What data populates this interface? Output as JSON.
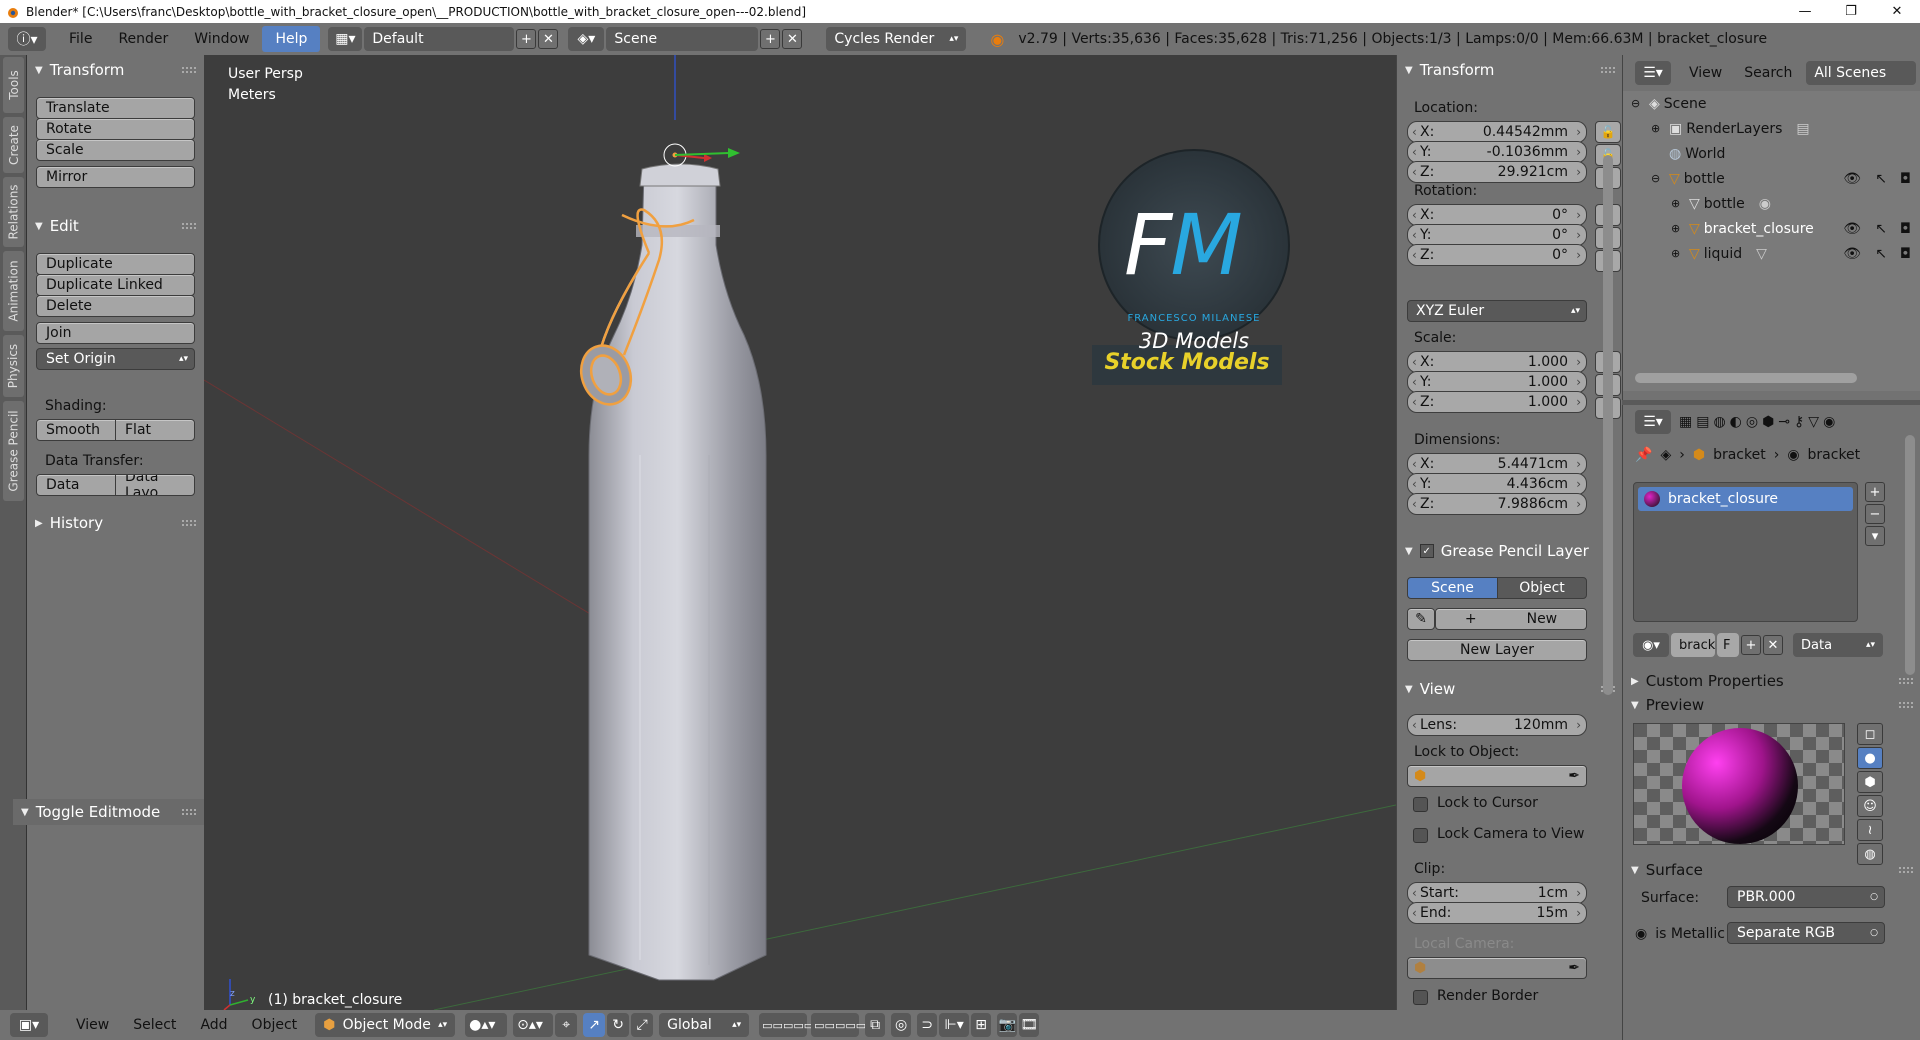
{
  "window": {
    "title": "Blender* [C:\\Users\\franc\\Desktop\\bottle_with_bracket_closure_open\\__PRODUCTION\\bottle_with_bracket_closure_open---02.blend]",
    "minimize": "—",
    "maximize": "❐",
    "close": "✕"
  },
  "menubar": {
    "items": [
      "File",
      "Render",
      "Window",
      "Help"
    ],
    "active": "Help",
    "layout": "Default",
    "scene": "Scene",
    "engine": "Cycles Render",
    "stats": "v2.79 | Verts:35,636 | Faces:35,628 | Tris:71,256 | Objects:1/3 | Lamps:0/0 | Mem:66.63M | bracket_closure"
  },
  "vtabs": [
    "Tools",
    "Create",
    "Relations",
    "Animation",
    "Physics",
    "Grease Pencil"
  ],
  "toolshelf": {
    "transform_title": "Transform",
    "translate": "Translate",
    "rotate": "Rotate",
    "scale": "Scale",
    "mirror": "Mirror",
    "edit_title": "Edit",
    "duplicate": "Duplicate",
    "duplicate_linked": "Duplicate Linked",
    "delete": "Delete",
    "join": "Join",
    "set_origin": "Set Origin",
    "shading_label": "Shading:",
    "smooth": "Smooth",
    "flat": "Flat",
    "data_transfer_label": "Data Transfer:",
    "data": "Data",
    "data_layout": "Data Layo",
    "history_title": "History",
    "toggle_editmode": "Toggle Editmode"
  },
  "viewport": {
    "view_name": "User Persp",
    "units": "Meters",
    "active_object": "(1) bracket_closure",
    "watermark": {
      "initials_f": "F",
      "initials_m": "M",
      "name": "FRANCESCO MILANESE",
      "tagline": "3D Models",
      "stock": "Stock Models"
    }
  },
  "npanel": {
    "transform_title": "Transform",
    "location_label": "Location:",
    "loc": [
      {
        "k": "X:",
        "v": "0.44542mm"
      },
      {
        "k": "Y:",
        "v": "-0.1036mm"
      },
      {
        "k": "Z:",
        "v": "29.921cm"
      }
    ],
    "rotation_label": "Rotation:",
    "rot": [
      {
        "k": "X:",
        "v": "0°"
      },
      {
        "k": "Y:",
        "v": "0°"
      },
      {
        "k": "Z:",
        "v": "0°"
      }
    ],
    "rotation_mode": "XYZ Euler",
    "scale_label": "Scale:",
    "scale": [
      {
        "k": "X:",
        "v": "1.000"
      },
      {
        "k": "Y:",
        "v": "1.000"
      },
      {
        "k": "Z:",
        "v": "1.000"
      }
    ],
    "dimensions_label": "Dimensions:",
    "dims": [
      {
        "k": "X:",
        "v": "5.4471cm"
      },
      {
        "k": "Y:",
        "v": "4.436cm"
      },
      {
        "k": "Z:",
        "v": "7.9886cm"
      }
    ],
    "grease_title": "Grease Pencil Layer",
    "scene_btn": "Scene",
    "object_btn": "Object",
    "new_btn": "New",
    "new_layer_btn": "New Layer",
    "view_title": "View",
    "lens_label": "Lens:",
    "lens_value": "120mm",
    "lock_to_object_label": "Lock to Object:",
    "lock_to_cursor": "Lock to Cursor",
    "lock_camera": "Lock Camera to View",
    "clip_label": "Clip:",
    "clip_start_label": "Start:",
    "clip_start": "1cm",
    "clip_end_label": "End:",
    "clip_end": "15m",
    "local_camera_label": "Local Camera:",
    "render_border": "Render Border"
  },
  "outliner": {
    "view": "View",
    "search": "Search",
    "filter": "All Scenes",
    "rows": [
      {
        "label": "Scene",
        "indent": 0
      },
      {
        "label": "RenderLayers",
        "indent": 1
      },
      {
        "label": "World",
        "indent": 1
      },
      {
        "label": "bottle",
        "indent": 1
      },
      {
        "label": "bottle",
        "indent": 2
      },
      {
        "label": "bracket_closure",
        "indent": 2
      },
      {
        "label": "liquid",
        "indent": 2
      }
    ]
  },
  "properties": {
    "breadcrumb_obj": "bracket",
    "breadcrumb_mat": "bracket",
    "material_slot": "bracket_closure",
    "mat_name": "brack",
    "fake_user": "F",
    "link": "Data",
    "custom_props": "Custom Properties",
    "preview": "Preview",
    "surface_title": "Surface",
    "surface_label": "Surface:",
    "surface_value": "PBR.000",
    "is_metallic_label": "is Metallic",
    "is_metallic_value": "Separate RGB"
  },
  "bottombar": {
    "view": "View",
    "select": "Select",
    "add": "Add",
    "object": "Object",
    "mode": "Object Mode",
    "orientation": "Global"
  },
  "colors": {
    "accent": "#5680c2",
    "panel": "#727272",
    "viewport": "#3d3d3d",
    "selected_outline": "#f0a040"
  }
}
